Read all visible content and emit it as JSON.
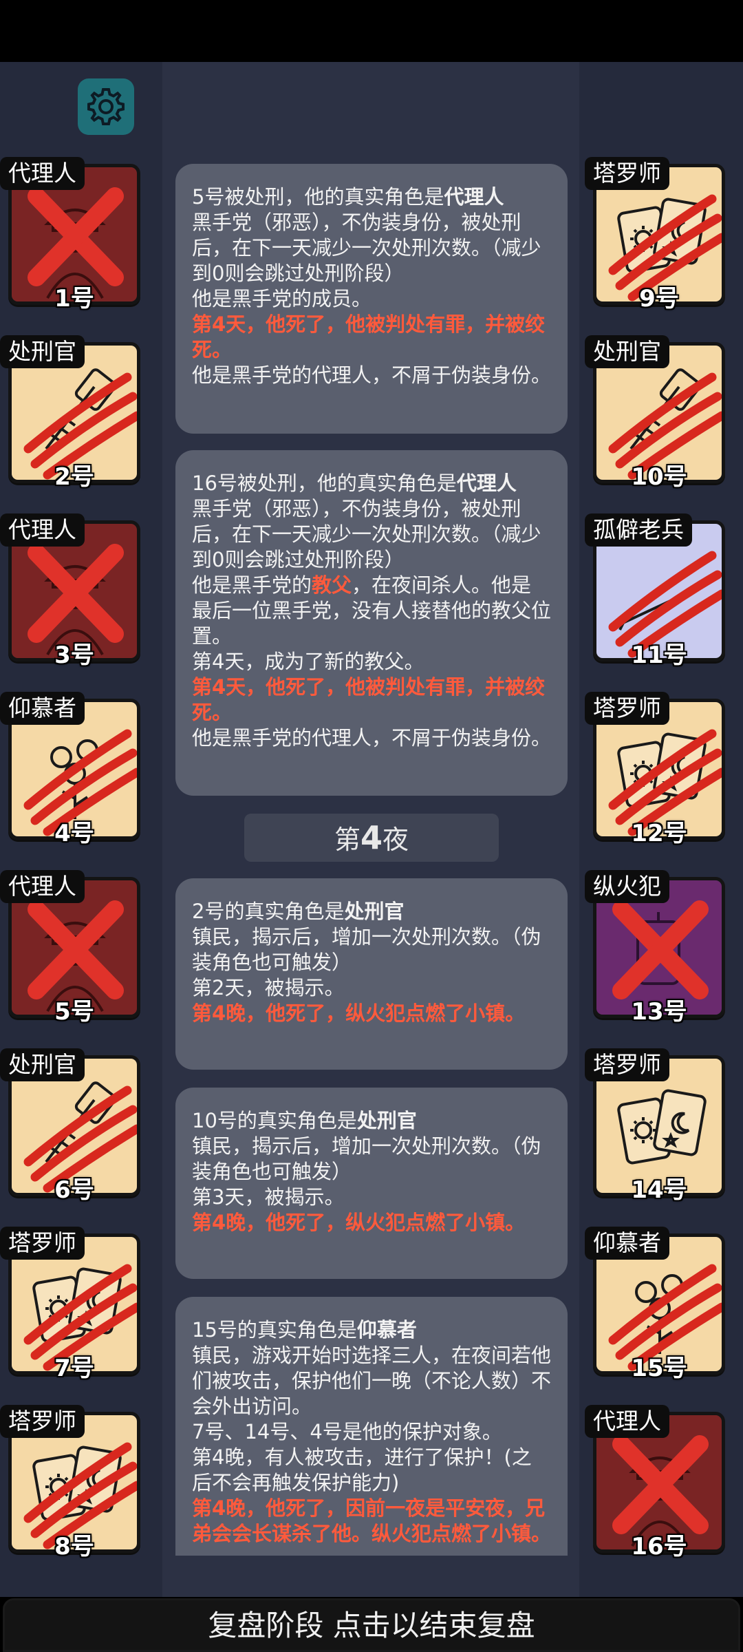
{
  "settings_icon": "gear-icon",
  "players": [
    {
      "role": "代理人",
      "seat": "1号",
      "tag_color": "#ffffff",
      "status": "x",
      "art": "agent",
      "bg": "#7a2424"
    },
    {
      "role": "处刑官",
      "seat": "2号",
      "tag_color": "#ffffff",
      "status": "claw",
      "art": "exec",
      "bg": "#f5d9a6"
    },
    {
      "role": "代理人",
      "seat": "3号",
      "tag_color": "#ffffff",
      "status": "x",
      "art": "agent",
      "bg": "#7a2424"
    },
    {
      "role": "仰慕者",
      "seat": "4号",
      "tag_color": "#ffffff",
      "status": "claw",
      "art": "admirer",
      "bg": "#f5d9a6"
    },
    {
      "role": "代理人",
      "seat": "5号",
      "tag_color": "#ffffff",
      "status": "x",
      "art": "agent",
      "bg": "#7a2424"
    },
    {
      "role": "处刑官",
      "seat": "6号",
      "tag_color": "#ffffff",
      "status": "claw",
      "art": "exec",
      "bg": "#f5d9a6"
    },
    {
      "role": "塔罗师",
      "seat": "7号",
      "tag_color": "#ffffff",
      "status": "claw",
      "art": "tarot",
      "bg": "#f5d9a6"
    },
    {
      "role": "塔罗师",
      "seat": "8号",
      "tag_color": "#ffffff",
      "status": "claw",
      "art": "tarot",
      "bg": "#f5d9a6"
    },
    {
      "role": "塔罗师",
      "seat": "9号",
      "tag_color": "#ffffff",
      "status": "claw",
      "art": "tarot",
      "bg": "#f5d9a6"
    },
    {
      "role": "处刑官",
      "seat": "10号",
      "tag_color": "#ffffff",
      "status": "claw",
      "art": "exec",
      "bg": "#f5d9a6"
    },
    {
      "role": "孤僻老兵",
      "seat": "11号",
      "tag_color": "#ffffff",
      "status": "claw",
      "art": "veteran",
      "bg": "#c9cbef"
    },
    {
      "role": "塔罗师",
      "seat": "12号",
      "tag_color": "#ffffff",
      "status": "claw",
      "art": "tarot",
      "bg": "#f5d9a6"
    },
    {
      "role": "纵火犯",
      "seat": "13号",
      "tag_color": "#ffffff",
      "status": "x",
      "art": "arson",
      "bg": "#6a2a6e"
    },
    {
      "role": "塔罗师",
      "seat": "14号",
      "tag_color": "#ffffff",
      "status": "alive",
      "art": "tarot",
      "bg": "#f5d9a6"
    },
    {
      "role": "仰慕者",
      "seat": "15号",
      "tag_color": "#ffffff",
      "status": "claw",
      "art": "admirer",
      "bg": "#f5d9a6"
    },
    {
      "role": "代理人",
      "seat": "16号",
      "tag_color": "#ffffff",
      "status": "x",
      "art": "agent",
      "bg": "#7a2424"
    }
  ],
  "log": {
    "entry1": {
      "head": "5号被处刑，他的真实角色是",
      "head_role": "代理人",
      "desc": "黑手党（邪恶），不伪装身份，被处刑后，在下一天减少一次处刑次数。（减少到0则会跳过处刑阶段）",
      "l2": "他是黑手党的成员。",
      "death": "第4天，他死了，他被判处有罪，并被绞死。",
      "l3": "他是黑手党的代理人，不屑于伪装身份。"
    },
    "entry2": {
      "head": "16号被处刑，他的真实角色是",
      "head_role": "代理人",
      "desc": "黑手党（邪恶），不伪装身份，被处刑后，在下一天减少一次处刑次数。（减少到0则会跳过处刑阶段）",
      "l2a": "他是黑手党的",
      "l2_red": "教父",
      "l2b": "，在夜间杀人。他是最后一位黑手党，没有人接替他的教父位置。",
      "l3": "第4天，成为了新的教父。",
      "death": "第4天，他死了，他被判处有罪，并被绞死。",
      "l4": "他是黑手党的代理人，不屑于伪装身份。"
    },
    "night_prefix": "第",
    "night_num": "4",
    "night_suffix": "夜",
    "entry3": {
      "head": "2号的真实角色是",
      "head_role": "处刑官",
      "desc": "镇民，揭示后，增加一次处刑次数。（伪装角色也可触发）",
      "l2": "第2天，被揭示。",
      "death": "第4晚，他死了，纵火犯点燃了小镇。"
    },
    "entry4": {
      "head": "10号的真实角色是",
      "head_role": "处刑官",
      "desc": "镇民，揭示后，增加一次处刑次数。（伪装角色也可触发）",
      "l2": "第3天，被揭示。",
      "death": "第4晚，他死了，纵火犯点燃了小镇。"
    },
    "entry5": {
      "head": "15号的真实角色是",
      "head_role": "仰慕者",
      "desc": "镇民，游戏开始时选择三人，在夜间若他们被攻击，保护他们一晚（不论人数）不会外出访问。",
      "l2": "7号、14号、4号是他的保护对象。",
      "l3": "第4晚，有人被攻击，进行了保护！(之后不会再触发保护能力)",
      "death": "第4晚，他死了，因前一夜是平安夜，兄弟会会长谋杀了他。纵火犯点燃了小镇。"
    }
  },
  "footer": {
    "label": "复盘阶段 点击以结束复盘"
  }
}
